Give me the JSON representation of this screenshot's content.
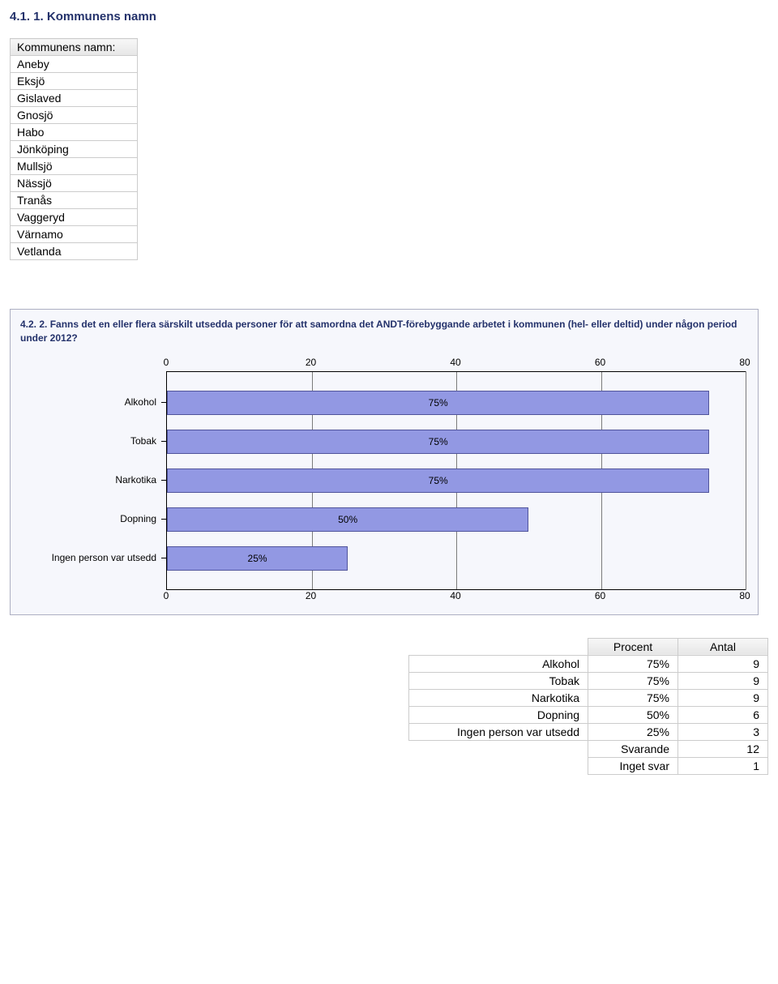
{
  "section1": {
    "title": "4.1. 1. Kommunens namn",
    "table_header": "Kommunens namn:",
    "rows": [
      "Aneby",
      "Eksjö",
      "Gislaved",
      "Gnosjö",
      "Habo",
      "Jönköping",
      "Mullsjö",
      "Nässjö",
      "Tranås",
      "Vaggeryd",
      "Värnamo",
      "Vetlanda"
    ]
  },
  "chart_data": {
    "type": "bar",
    "title": "4.2. 2. Fanns det en eller flera särskilt utsedda personer för att samordna det ANDT-förebyggande arbetet i kommunen (hel- eller deltid) under någon period under 2012?",
    "categories": [
      "Alkohol",
      "Tobak",
      "Narkotika",
      "Dopning",
      "Ingen person var utsedd"
    ],
    "values": [
      75,
      75,
      75,
      50,
      25
    ],
    "value_labels": [
      "75%",
      "75%",
      "75%",
      "50%",
      "25%"
    ],
    "xlabel": "",
    "ylabel": "",
    "xlim": [
      0,
      80
    ],
    "ticks": [
      0,
      20,
      40,
      60,
      80
    ]
  },
  "data_table": {
    "headers": [
      "Procent",
      "Antal"
    ],
    "rows": [
      {
        "label": "Alkohol",
        "procent": "75%",
        "antal": "9"
      },
      {
        "label": "Tobak",
        "procent": "75%",
        "antal": "9"
      },
      {
        "label": "Narkotika",
        "procent": "75%",
        "antal": "9"
      },
      {
        "label": "Dopning",
        "procent": "50%",
        "antal": "6"
      },
      {
        "label": "Ingen person var utsedd",
        "procent": "25%",
        "antal": "3"
      }
    ],
    "footer": [
      {
        "label": "Svarande",
        "value": "12"
      },
      {
        "label": "Inget svar",
        "value": "1"
      }
    ]
  }
}
